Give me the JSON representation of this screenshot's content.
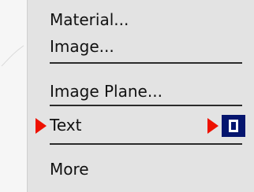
{
  "menu": {
    "items": {
      "material": "Material...",
      "image": "Image...",
      "image_plane": "Image Plane...",
      "text": "Text",
      "more": "More"
    }
  },
  "icons": {
    "submenu_indicator": "red-triangle-icon",
    "option_box": "option-box-icon"
  },
  "colors": {
    "menu_bg": "#e3e3e3",
    "arrow": "#ee1100",
    "option_box_bg": "#05156e",
    "separator": "#2b2b2b"
  }
}
